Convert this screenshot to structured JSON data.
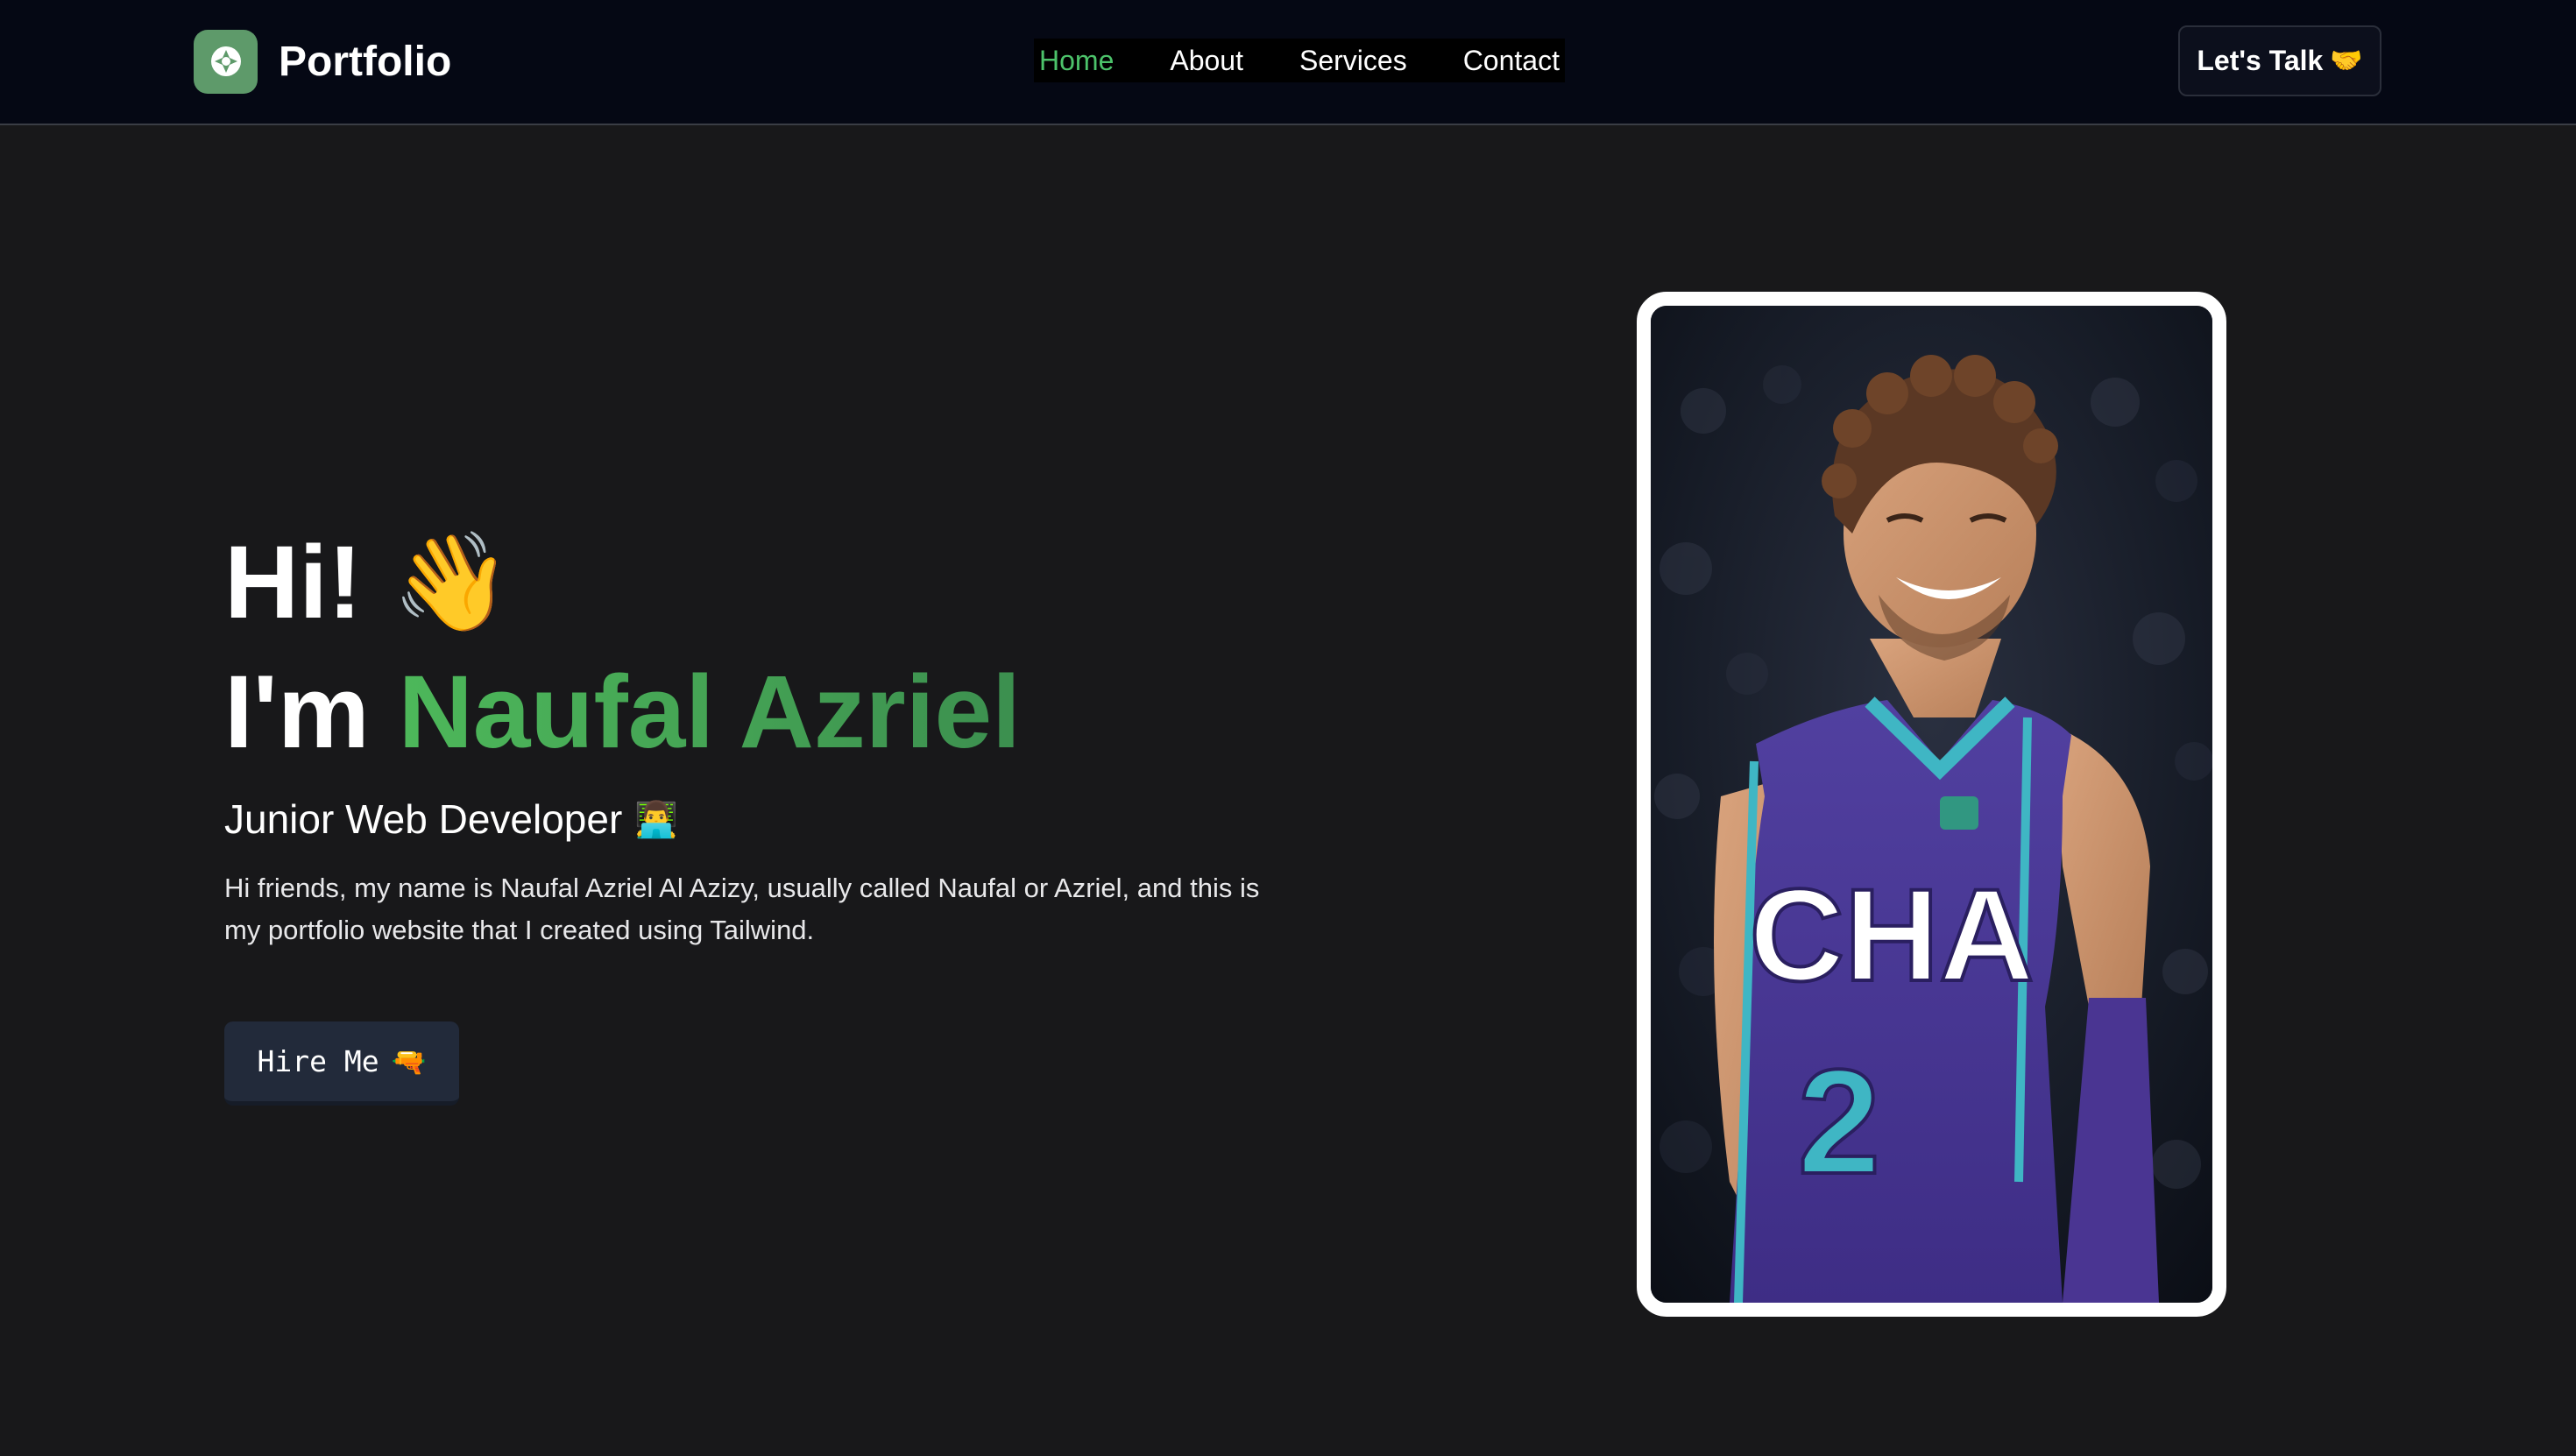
{
  "navbar": {
    "brand": {
      "logo_icon": "portfolio-logo-icon",
      "name": "Portfolio"
    },
    "links": [
      {
        "label": "Home",
        "active": true
      },
      {
        "label": "About",
        "active": false
      },
      {
        "label": "Services",
        "active": false
      },
      {
        "label": "Contact",
        "active": false
      }
    ],
    "cta": {
      "label": "Let's Talk",
      "emoji": "🤝"
    }
  },
  "hero": {
    "greeting": "Hi!",
    "greeting_emoji": "👋",
    "intro_prefix": "I'm",
    "name": "Naufal Azriel",
    "role": "Junior Web Developer",
    "role_emoji": "👨‍💻",
    "bio": "Hi friends, my name is Naufal Azriel Al Azizy, usually called Naufal or Azriel, and this is my portfolio website that I created using Tailwind.",
    "button": {
      "label": "Hire Me",
      "emoji": "🔫"
    }
  },
  "photo": {
    "jersey_text": "CHA",
    "jersey_number": "2"
  },
  "colors": {
    "accent_green": "#4cc26a",
    "name_gradient_start": "#4db85a",
    "name_gradient_end": "#3c8f4f",
    "navbar_bg": "#050814",
    "page_bg": "#18181a",
    "button_bg": "#222a3a",
    "logo_bg": "#5e9a6a",
    "jersey_purple": "#4a3592",
    "jersey_teal": "#3fb6c4"
  }
}
